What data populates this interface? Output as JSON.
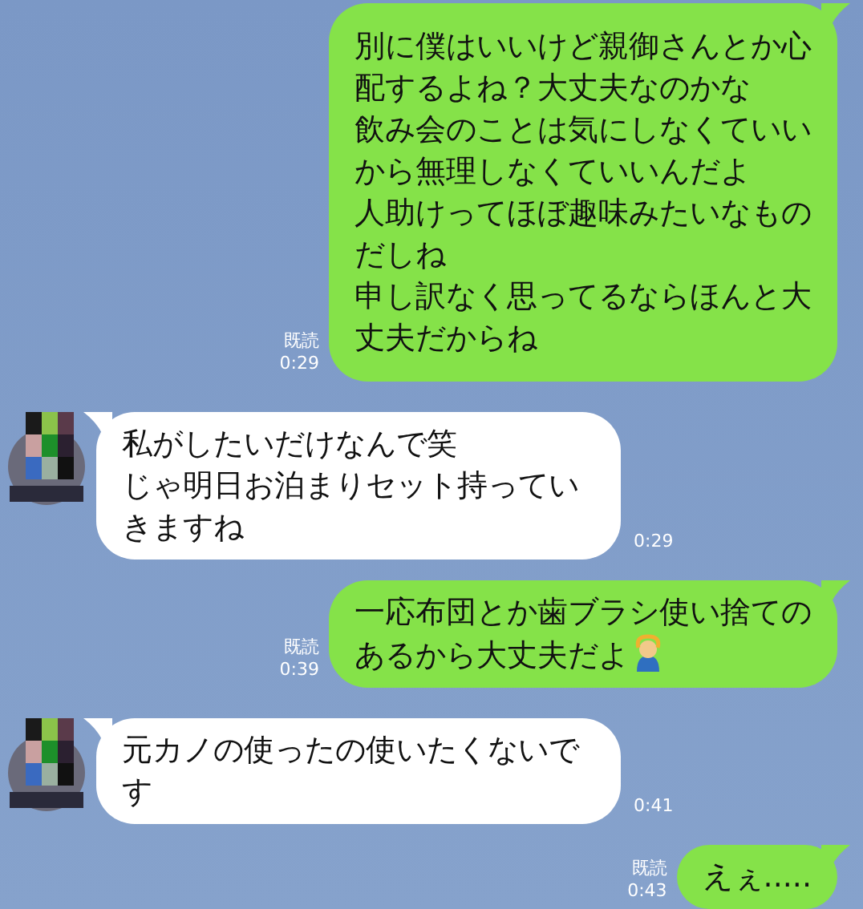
{
  "messages": [
    {
      "kind": "sent",
      "lines": [
        "別に僕はいいけど親御さんとか心",
        "配するよね？大丈夫なのかな",
        "飲み会のことは気にしなくていい",
        "から無理しなくていいんだよ",
        "人助けってほぼ趣味みたいなもの",
        "だしね",
        "申し訳なく思ってるならほんと大",
        "丈夫だからね"
      ],
      "read": "既読",
      "time": "0:29"
    },
    {
      "kind": "received",
      "lines": [
        "私がしたいだけなんで笑",
        "じゃ明日お泊まりセット持ってい",
        "きますね"
      ],
      "time": "0:29"
    },
    {
      "kind": "sent",
      "lines": [
        "一応布団とか歯ブラシ使い捨ての",
        "あるから大丈夫だよ"
      ],
      "trailing_icon": true,
      "read": "既読",
      "time": "0:39"
    },
    {
      "kind": "received",
      "lines": [
        "元カノの使ったの使いたくないで",
        "す"
      ],
      "time": "0:41"
    },
    {
      "kind": "sent",
      "lines": [
        "えぇ....."
      ],
      "read": "既読",
      "time": "0:43"
    }
  ]
}
